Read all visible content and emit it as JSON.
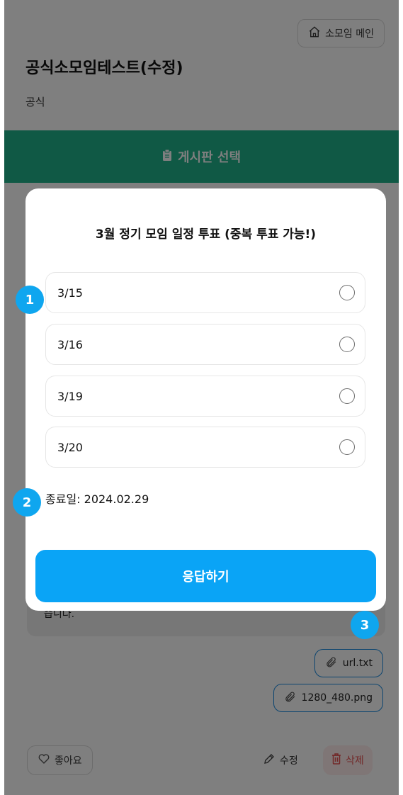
{
  "header": {
    "main_button_label": "소모임 메인",
    "group_title": "공식소모임테스트(수정)",
    "group_subtitle": "공식"
  },
  "board_selector": {
    "label": "게시판 선택"
  },
  "post": {
    "body_text_partial": "습니다.",
    "attachments": [
      {
        "name": "url.txt"
      },
      {
        "name": "1280_480.png"
      }
    ]
  },
  "actions": {
    "like_label": "좋아요",
    "edit_label": "수정",
    "delete_label": "삭제"
  },
  "poll_modal": {
    "title": "3월 정기 모임 일정 투표 (중복 투표 가능!)",
    "options": [
      {
        "label": "3/15",
        "selected": false
      },
      {
        "label": "3/16",
        "selected": false
      },
      {
        "label": "3/19",
        "selected": false
      },
      {
        "label": "3/20",
        "selected": false
      }
    ],
    "end_date_text": "종료일: 2024.02.29",
    "submit_label": "응답하기"
  },
  "annotation_badges": [
    "1",
    "2",
    "3"
  ],
  "colors": {
    "board_bar": "#20b28a",
    "submit_button": "#0aa4f6",
    "badge": "#0fa6ef",
    "file_chip_border": "#1a8be0",
    "delete_text": "#e45151",
    "overlay": "rgba(0,0,0,0.5)"
  },
  "icons": {
    "main_button": "home-icon",
    "board_selector": "clipboard-icon",
    "attachment": "paperclip-icon",
    "like": "heart-icon",
    "edit": "pencil-icon",
    "delete": "trash-icon",
    "option": "radio-icon"
  }
}
